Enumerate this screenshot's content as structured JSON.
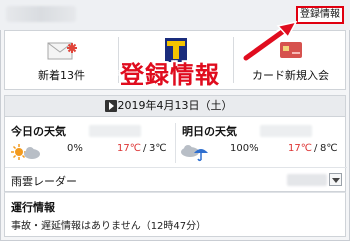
{
  "header": {
    "register_button": "登録情報"
  },
  "quick_links": [
    {
      "label": "新着13件",
      "icon": "mail-icon"
    },
    {
      "label": "",
      "icon": "t-point-icon"
    },
    {
      "label": "カード新規入会",
      "icon": "credit-card-icon"
    }
  ],
  "annotation": {
    "text": "登録情報",
    "color": "#e00c1e"
  },
  "date_bar": {
    "date": "2019年4月13日（土）"
  },
  "weather": {
    "today": {
      "title": "今日の天気",
      "precip": "0%",
      "high": "17℃",
      "low": "3℃",
      "icon": "sun-cloud-icon"
    },
    "tomorrow": {
      "title": "明日の天気",
      "precip": "100%",
      "high": "17℃",
      "low": "8℃",
      "icon": "cloud-umbrella-icon"
    },
    "radar_label": "雨雲レーダー"
  },
  "train": {
    "title": "運行情報",
    "message": "事故・遅延情報はありません（12時47分）"
  }
}
